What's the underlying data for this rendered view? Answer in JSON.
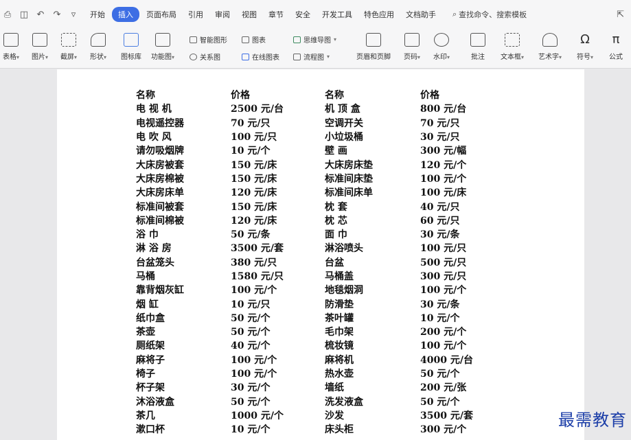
{
  "menubar": {
    "items": [
      "开始",
      "插入",
      "页面布局",
      "引用",
      "审阅",
      "视图",
      "章节",
      "安全",
      "开发工具",
      "特色应用",
      "文档助手"
    ],
    "active_index": 1,
    "search_label": "查找命令、搜索模板"
  },
  "ribbon": {
    "table": "表格",
    "picture": "图片",
    "screenshot": "截屏",
    "shapes": "形状",
    "icon_lib": "图标库",
    "func_chart": "功能图",
    "smart_art": "智能图形",
    "chart": "图表",
    "mind_map": "思维导图",
    "relation": "关系图",
    "online_chart": "在线图表",
    "flowchart": "流程图",
    "header_footer": "页眉和页脚",
    "page_num": "页码",
    "watermark": "水印",
    "comment": "批注",
    "textbox": "文本框",
    "wordart": "艺术字",
    "symbol": "符号",
    "formula": "公式"
  },
  "table_rows": [
    [
      "名称",
      "价格",
      "名称",
      "价格"
    ],
    [
      "电 视 机",
      "2500 元/台",
      "机 顶 盒",
      "800 元/台"
    ],
    [
      "电视遥控器",
      "70 元/只",
      "空调开关",
      "70 元/只"
    ],
    [
      "电 吹 风",
      "100 元/只",
      "小垃圾桶",
      "30 元/只"
    ],
    [
      "请勿吸烟牌",
      "10 元/个",
      "壁 画",
      "300 元/幅"
    ],
    [
      "大床房被套",
      "150 元/床",
      "大床房床垫",
      "120 元/个"
    ],
    [
      "大床房棉被",
      "150 元/床",
      "标准间床垫",
      "100 元/个"
    ],
    [
      "大床房床单",
      "120 元/床",
      "标准间床单",
      "100 元/床"
    ],
    [
      "标准间被套",
      "150 元/床",
      "枕 套",
      "40 元/只"
    ],
    [
      "标准间棉被",
      "120 元/床",
      "枕 芯",
      "60 元/只"
    ],
    [
      "浴 巾",
      "50 元/条",
      "面 巾",
      "30 元/条"
    ],
    [
      "淋 浴 房",
      "3500 元/套",
      "淋浴喷头",
      "100 元/只"
    ],
    [
      "台盆笼头",
      "380 元/只",
      "台盆",
      "500 元/只"
    ],
    [
      "马桶",
      "1580 元/只",
      "马桶盖",
      "300 元/只"
    ],
    [
      "靠背烟灰缸",
      "100 元/个",
      "地毯烟洞",
      "100 元/个"
    ],
    [
      "烟 缸",
      "10 元/只",
      "防滑垫",
      "30 元/条"
    ],
    [
      "纸巾盒",
      "50 元/个",
      "茶叶罐",
      "10 元/个"
    ],
    [
      "茶壶",
      "50 元/个",
      "毛巾架",
      "200 元/个"
    ],
    [
      "厕纸架",
      "40 元/个",
      "梳妆镜",
      "100 元/个"
    ],
    [
      "麻将子",
      "100 元/个",
      "麻将机",
      "4000 元/台"
    ],
    [
      "椅子",
      "100 元/个",
      "热水壶",
      "50 元/个"
    ],
    [
      "杯子架",
      "30 元/个",
      "墙纸",
      "200 元/张"
    ],
    [
      "沐浴液盒",
      "50 元/个",
      "洗发液盒",
      "50 元/个"
    ],
    [
      "茶几",
      "1000 元/个",
      "沙发",
      "3500 元/套"
    ],
    [
      "漱口杯",
      "10 元/个",
      "床头柜",
      "300 元/个"
    ]
  ],
  "watermark_text": "最需教育"
}
